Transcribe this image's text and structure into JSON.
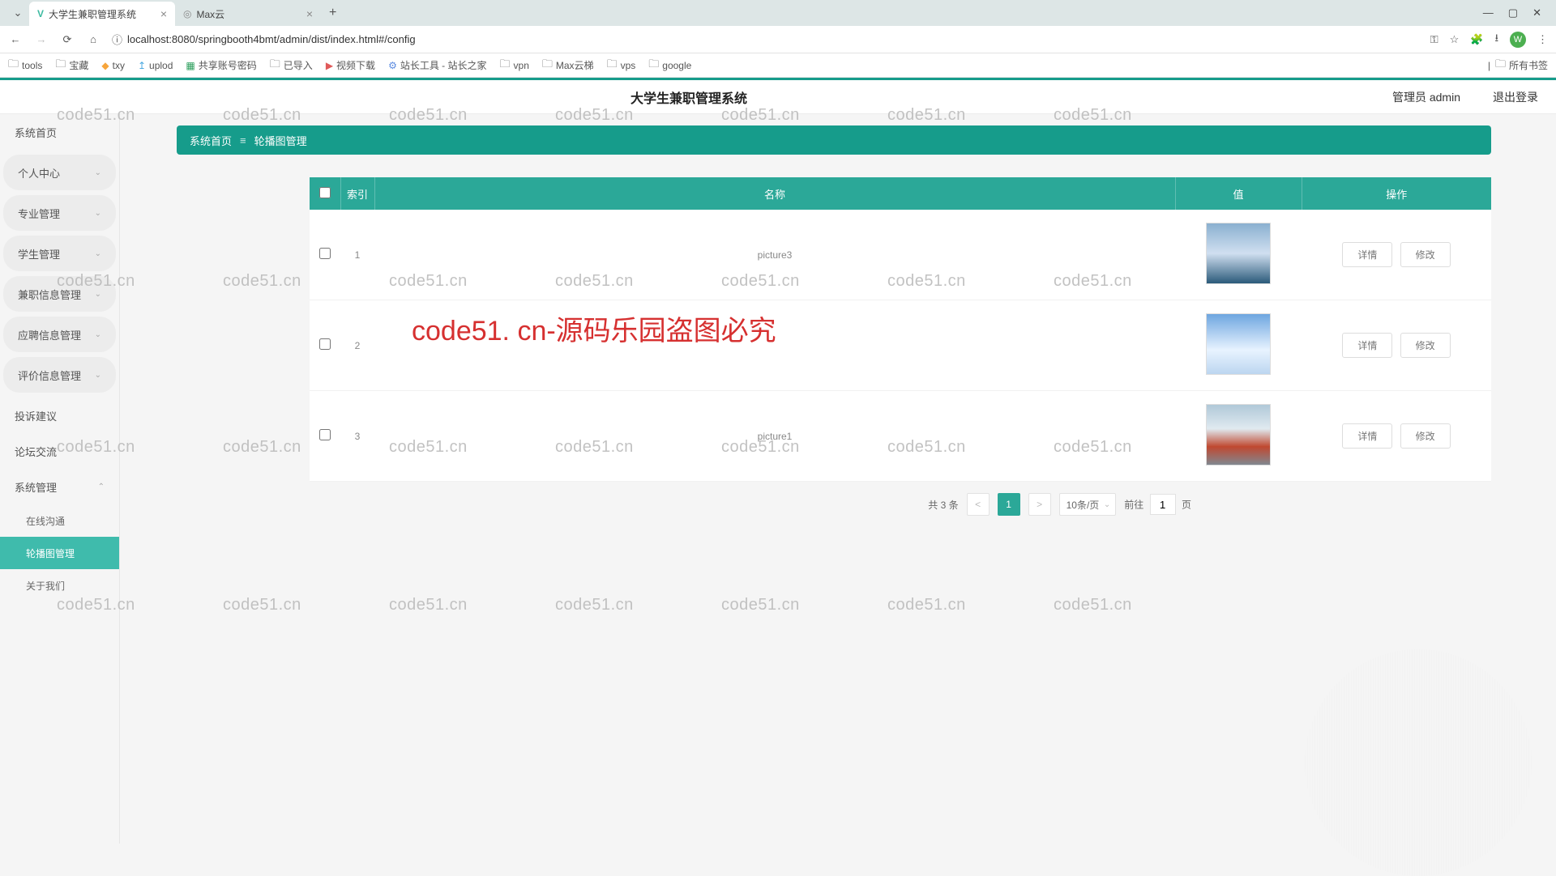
{
  "browser": {
    "tabs": [
      {
        "title": "大学生兼职管理系统",
        "favicon": "V"
      },
      {
        "title": "Max云",
        "favicon": "◎"
      }
    ],
    "url": "localhost:8080/springbooth4bmt/admin/dist/index.html#/config",
    "avatar_letter": "W",
    "bookmarks": [
      "tools",
      "宝藏",
      "txy",
      "uplod",
      "共享账号密码",
      "已导入",
      "视频下载",
      "站长工具 - 站长之家",
      "vpn",
      "Max云梯",
      "vps",
      "google"
    ],
    "all_bookmarks": "所有书签"
  },
  "header": {
    "title": "大学生兼职管理系统",
    "user": "管理员 admin",
    "logout": "退出登录"
  },
  "sidebar": {
    "items": [
      {
        "label": "系统首页",
        "expandable": false
      },
      {
        "label": "个人中心",
        "expandable": true
      },
      {
        "label": "专业管理",
        "expandable": true
      },
      {
        "label": "学生管理",
        "expandable": true
      },
      {
        "label": "兼职信息管理",
        "expandable": true
      },
      {
        "label": "应聘信息管理",
        "expandable": true
      },
      {
        "label": "评价信息管理",
        "expandable": true
      },
      {
        "label": "投诉建议",
        "expandable": false
      },
      {
        "label": "论坛交流",
        "expandable": false
      },
      {
        "label": "系统管理",
        "expandable": true,
        "expanded": true
      }
    ],
    "subitems": [
      {
        "label": "在线沟通",
        "active": false
      },
      {
        "label": "轮播图管理",
        "active": true
      },
      {
        "label": "关于我们",
        "active": false
      }
    ]
  },
  "breadcrumb": {
    "home": "系统首页",
    "current": "轮播图管理"
  },
  "table": {
    "columns": {
      "index": "索引",
      "name": "名称",
      "value": "值",
      "ops": "操作"
    },
    "rows": [
      {
        "idx": "1",
        "name": "picture3"
      },
      {
        "idx": "2",
        "name": ""
      },
      {
        "idx": "3",
        "name": "picture1"
      }
    ],
    "btn_detail": "详情",
    "btn_edit": "修改"
  },
  "pagination": {
    "total": "共 3 条",
    "page": "1",
    "per_page": "10条/页",
    "goto_prefix": "前往",
    "goto_value": "1",
    "goto_suffix": "页"
  },
  "watermark": {
    "text": "code51.cn",
    "big": "code51. cn-源码乐园盗图必究"
  }
}
